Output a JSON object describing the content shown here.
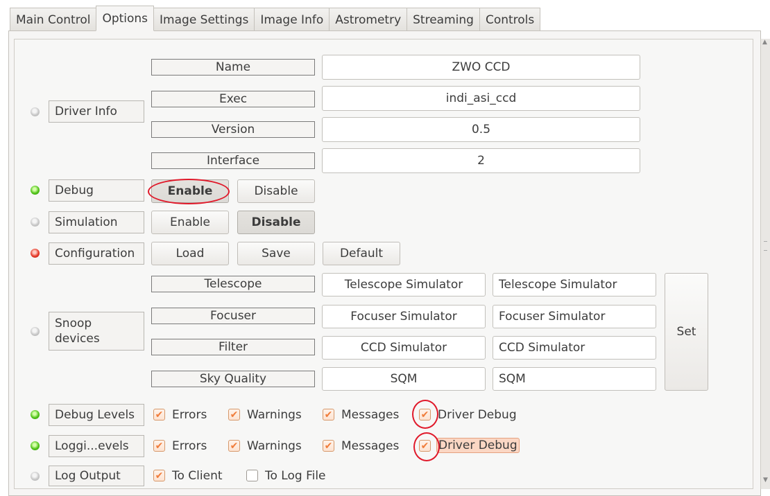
{
  "tabs": [
    "Main Control",
    "Options",
    "Image Settings",
    "Image Info",
    "Astrometry",
    "Streaming",
    "Controls"
  ],
  "active_tab": "Options",
  "driver_info": {
    "label": "Driver Info",
    "status": "grey",
    "rows": [
      {
        "label": "Name",
        "value": "ZWO CCD"
      },
      {
        "label": "Exec",
        "value": "indi_asi_ccd"
      },
      {
        "label": "Version",
        "value": "0.5"
      },
      {
        "label": "Interface",
        "value": "2"
      }
    ]
  },
  "debug": {
    "label": "Debug",
    "status": "green",
    "enable": "Enable",
    "disable": "Disable",
    "selected": "Enable"
  },
  "simulation": {
    "label": "Simulation",
    "status": "grey",
    "enable": "Enable",
    "disable": "Disable",
    "selected": "Disable"
  },
  "configuration": {
    "label": "Configuration",
    "status": "red",
    "load": "Load",
    "save": "Save",
    "default": "Default"
  },
  "snoop": {
    "label": "Snoop devices",
    "status": "grey",
    "set": "Set",
    "rows": [
      {
        "label": "Telescope",
        "value": "Telescope Simulator",
        "edit": "Telescope Simulator"
      },
      {
        "label": "Focuser",
        "value": "Focuser Simulator",
        "edit": "Focuser Simulator"
      },
      {
        "label": "Filter",
        "value": "CCD Simulator",
        "edit": "CCD Simulator"
      },
      {
        "label": "Sky Quality",
        "value": "SQM",
        "edit": "SQM"
      }
    ]
  },
  "debug_levels": {
    "label": "Debug Levels",
    "status": "green",
    "options": [
      {
        "label": "Errors",
        "checked": true
      },
      {
        "label": "Warnings",
        "checked": true
      },
      {
        "label": "Messages",
        "checked": true
      },
      {
        "label": "Driver Debug",
        "checked": true
      }
    ]
  },
  "logging_levels": {
    "label": "Loggi...evels",
    "status": "green",
    "options": [
      {
        "label": "Errors",
        "checked": true
      },
      {
        "label": "Warnings",
        "checked": true
      },
      {
        "label": "Messages",
        "checked": true
      },
      {
        "label": "Driver Debug",
        "checked": true
      }
    ]
  },
  "log_output": {
    "label": "Log Output",
    "status": "grey",
    "options": [
      {
        "label": "To Client",
        "checked": true
      },
      {
        "label": "To Log File",
        "checked": false
      }
    ]
  },
  "colors": {
    "check_accent": "#f07c3a",
    "annotation_ring": "#e0192a",
    "status_green": "#52c41a",
    "status_red": "#e63a2a"
  },
  "check_glyph": "✔"
}
